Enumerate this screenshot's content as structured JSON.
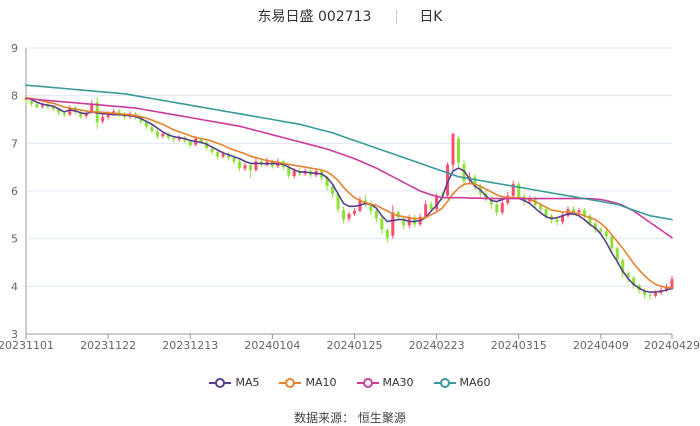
{
  "title": {
    "stock": "东易日盛 002713",
    "period": "日K"
  },
  "source": "数据来源：  恒生聚源",
  "colors": {
    "up": "#ff4d6d",
    "down": "#8ae234",
    "grid": "#dfe6f3",
    "axis": "#666666"
  },
  "chart_data": {
    "type": "candlestick",
    "ylim": [
      3,
      9
    ],
    "yticks": [
      3,
      4,
      5,
      6,
      7,
      8,
      9
    ],
    "xticks": [
      "20231101",
      "20231122",
      "20231213",
      "20240104",
      "20240125",
      "20240223",
      "20240315",
      "20240409",
      "20240429"
    ],
    "x_tick_index": [
      0,
      15,
      30,
      45,
      60,
      75,
      90,
      105,
      118
    ],
    "candles": [
      [
        7.95,
        7.9,
        7.99,
        7.84
      ],
      [
        7.89,
        7.82,
        7.94,
        7.78
      ],
      [
        7.82,
        7.76,
        7.86,
        7.72
      ],
      [
        7.77,
        7.8,
        7.85,
        7.73
      ],
      [
        7.82,
        7.76,
        7.86,
        7.71
      ],
      [
        7.77,
        7.72,
        7.8,
        7.67
      ],
      [
        7.71,
        7.64,
        7.75,
        7.58
      ],
      [
        7.63,
        7.6,
        7.69,
        7.55
      ],
      [
        7.6,
        7.74,
        7.8,
        7.57
      ],
      [
        7.75,
        7.66,
        7.8,
        7.6
      ],
      [
        7.66,
        7.56,
        7.71,
        7.51
      ],
      [
        7.57,
        7.64,
        7.69,
        7.53
      ],
      [
        7.65,
        7.82,
        7.9,
        7.62
      ],
      [
        7.86,
        7.44,
        7.96,
        7.3
      ],
      [
        7.46,
        7.55,
        7.6,
        7.41
      ],
      [
        7.55,
        7.62,
        7.68,
        7.5
      ],
      [
        7.62,
        7.67,
        7.72,
        7.58
      ],
      [
        7.68,
        7.62,
        7.72,
        7.56
      ],
      [
        7.61,
        7.55,
        7.66,
        7.5
      ],
      [
        7.56,
        7.62,
        7.67,
        7.52
      ],
      [
        7.62,
        7.55,
        7.66,
        7.5
      ],
      [
        7.55,
        7.45,
        7.58,
        7.4
      ],
      [
        7.44,
        7.35,
        7.48,
        7.3
      ],
      [
        7.34,
        7.26,
        7.38,
        7.21
      ],
      [
        7.25,
        7.14,
        7.29,
        7.09
      ],
      [
        7.15,
        7.2,
        7.25,
        7.1
      ],
      [
        7.2,
        7.12,
        7.24,
        7.07
      ],
      [
        7.11,
        7.08,
        7.15,
        7.02
      ],
      [
        7.08,
        7.12,
        7.17,
        7.03
      ],
      [
        7.12,
        7.05,
        7.16,
        7.0
      ],
      [
        7.04,
        6.96,
        7.08,
        6.9
      ],
      [
        6.97,
        7.1,
        7.15,
        6.93
      ],
      [
        7.1,
        7.03,
        7.14,
        6.98
      ],
      [
        7.02,
        6.9,
        7.06,
        6.85
      ],
      [
        6.89,
        6.82,
        6.93,
        6.77
      ],
      [
        6.82,
        6.72,
        6.86,
        6.66
      ],
      [
        6.72,
        6.78,
        6.83,
        6.68
      ],
      [
        6.78,
        6.7,
        6.82,
        6.64
      ],
      [
        6.7,
        6.62,
        6.75,
        6.56
      ],
      [
        6.62,
        6.48,
        6.66,
        6.42
      ],
      [
        6.47,
        6.54,
        6.59,
        6.42
      ],
      [
        6.54,
        6.44,
        6.58,
        6.28
      ],
      [
        6.44,
        6.62,
        6.72,
        6.4
      ],
      [
        6.62,
        6.55,
        6.68,
        6.5
      ],
      [
        6.55,
        6.62,
        6.7,
        6.51
      ],
      [
        6.62,
        6.52,
        6.66,
        6.47
      ],
      [
        6.52,
        6.62,
        6.68,
        6.48
      ],
      [
        6.62,
        6.5,
        6.66,
        6.45
      ],
      [
        6.5,
        6.32,
        6.55,
        6.26
      ],
      [
        6.31,
        6.42,
        6.48,
        6.27
      ],
      [
        6.42,
        6.36,
        6.48,
        6.31
      ],
      [
        6.36,
        6.42,
        6.47,
        6.32
      ],
      [
        6.42,
        6.33,
        6.46,
        6.28
      ],
      [
        6.33,
        6.42,
        6.48,
        6.29
      ],
      [
        6.42,
        6.28,
        6.46,
        6.22
      ],
      [
        6.28,
        6.1,
        6.32,
        6.02
      ],
      [
        6.1,
        5.94,
        6.13,
        5.86
      ],
      [
        5.94,
        5.62,
        5.97,
        5.55
      ],
      [
        5.6,
        5.4,
        5.68,
        5.32
      ],
      [
        5.42,
        5.52,
        5.56,
        5.36
      ],
      [
        5.52,
        5.58,
        5.64,
        5.48
      ],
      [
        5.58,
        5.8,
        5.88,
        5.55
      ],
      [
        5.8,
        5.74,
        5.92,
        5.66
      ],
      [
        5.74,
        5.58,
        5.8,
        5.5
      ],
      [
        5.58,
        5.42,
        5.63,
        5.34
      ],
      [
        5.42,
        5.2,
        5.46,
        5.1
      ],
      [
        5.18,
        5.02,
        5.22,
        4.92
      ],
      [
        5.06,
        5.55,
        5.7,
        5.0
      ],
      [
        5.55,
        5.45,
        5.6,
        5.38
      ],
      [
        5.42,
        5.28,
        5.48,
        5.2
      ],
      [
        5.28,
        5.44,
        5.5,
        5.22
      ],
      [
        5.44,
        5.3,
        5.5,
        5.24
      ],
      [
        5.3,
        5.46,
        5.52,
        5.26
      ],
      [
        5.46,
        5.72,
        5.8,
        5.42
      ],
      [
        5.72,
        5.62,
        5.78,
        5.56
      ],
      [
        5.62,
        5.88,
        5.95,
        5.58
      ],
      [
        5.88,
        5.86,
        5.98,
        5.8
      ],
      [
        5.9,
        6.55,
        6.6,
        5.88
      ],
      [
        6.55,
        7.2,
        7.22,
        6.45
      ],
      [
        7.1,
        6.6,
        7.15,
        6.5
      ],
      [
        6.56,
        6.2,
        6.65,
        6.1
      ],
      [
        6.22,
        6.3,
        6.4,
        6.15
      ],
      [
        6.3,
        6.1,
        6.35,
        6.02
      ],
      [
        6.1,
        5.95,
        6.15,
        5.88
      ],
      [
        5.95,
        5.85,
        6.02,
        5.78
      ],
      [
        5.85,
        5.72,
        5.9,
        5.62
      ],
      [
        5.72,
        5.55,
        5.78,
        5.48
      ],
      [
        5.55,
        5.75,
        5.8,
        5.5
      ],
      [
        5.75,
        5.9,
        5.98,
        5.7
      ],
      [
        5.9,
        6.15,
        6.22,
        5.85
      ],
      [
        6.15,
        5.88,
        6.2,
        5.82
      ],
      [
        5.88,
        5.78,
        5.95,
        5.7
      ],
      [
        5.78,
        5.85,
        5.9,
        5.72
      ],
      [
        5.85,
        5.7,
        5.9,
        5.64
      ],
      [
        5.7,
        5.62,
        5.75,
        5.55
      ],
      [
        5.62,
        5.48,
        5.66,
        5.42
      ],
      [
        5.48,
        5.4,
        5.52,
        5.32
      ],
      [
        5.4,
        5.35,
        5.45,
        5.28
      ],
      [
        5.35,
        5.48,
        5.55,
        5.3
      ],
      [
        5.48,
        5.62,
        5.68,
        5.44
      ],
      [
        5.62,
        5.55,
        5.68,
        5.5
      ],
      [
        5.55,
        5.6,
        5.65,
        5.5
      ],
      [
        5.6,
        5.48,
        5.64,
        5.42
      ],
      [
        5.48,
        5.32,
        5.52,
        5.25
      ],
      [
        5.32,
        5.2,
        5.36,
        5.12
      ],
      [
        5.2,
        5.15,
        5.24,
        5.08
      ],
      [
        5.15,
        5.05,
        5.2,
        4.98
      ],
      [
        5.05,
        4.8,
        5.08,
        4.72
      ],
      [
        4.8,
        4.55,
        4.84,
        4.45
      ],
      [
        4.55,
        4.28,
        4.6,
        4.18
      ],
      [
        4.28,
        4.18,
        4.32,
        4.08
      ],
      [
        4.18,
        4.02,
        4.22,
        3.95
      ],
      [
        4.02,
        3.92,
        4.06,
        3.85
      ],
      [
        3.92,
        3.82,
        3.96,
        3.74
      ],
      [
        3.82,
        3.8,
        3.88,
        3.72
      ],
      [
        3.8,
        3.86,
        3.92,
        3.76
      ],
      [
        3.86,
        3.92,
        3.98,
        3.82
      ],
      [
        3.92,
        3.98,
        4.05,
        3.88
      ],
      [
        3.95,
        4.15,
        4.22,
        3.92
      ]
    ],
    "series": [
      {
        "name": "MA5",
        "color": "#5b3d8c",
        "values": [
          7.95,
          7.92,
          7.86,
          7.82,
          7.8,
          7.78,
          7.72,
          7.66,
          7.7,
          7.68,
          7.64,
          7.62,
          7.66,
          7.64,
          7.62,
          7.62,
          7.6,
          7.6,
          7.59,
          7.58,
          7.56,
          7.52,
          7.46,
          7.4,
          7.32,
          7.24,
          7.18,
          7.14,
          7.12,
          7.1,
          7.06,
          7.04,
          7.02,
          6.98,
          6.92,
          6.86,
          6.8,
          6.76,
          6.72,
          6.68,
          6.62,
          6.58,
          6.58,
          6.58,
          6.57,
          6.58,
          6.57,
          6.56,
          6.5,
          6.44,
          6.4,
          6.4,
          6.38,
          6.37,
          6.36,
          6.28,
          6.14,
          5.94,
          5.74,
          5.68,
          5.68,
          5.7,
          5.74,
          5.72,
          5.64,
          5.48,
          5.36,
          5.38,
          5.4,
          5.4,
          5.36,
          5.36,
          5.38,
          5.44,
          5.58,
          5.7,
          5.86,
          6.18,
          6.42,
          6.48,
          6.42,
          6.26,
          6.1,
          6.02,
          5.9,
          5.8,
          5.78,
          5.82,
          5.86,
          5.86,
          5.85,
          5.8,
          5.74,
          5.64,
          5.54,
          5.46,
          5.42,
          5.44,
          5.48,
          5.52,
          5.52,
          5.48,
          5.4,
          5.3,
          5.22,
          5.1,
          4.92,
          4.7,
          4.52,
          4.32,
          4.16,
          4.04,
          3.96,
          3.9,
          3.88,
          3.88,
          3.9,
          3.92,
          3.96
        ]
      },
      {
        "name": "MA10",
        "color": "#e6822e",
        "values": [
          7.96,
          7.94,
          7.92,
          7.89,
          7.86,
          7.84,
          7.8,
          7.76,
          7.74,
          7.72,
          7.7,
          7.68,
          7.66,
          7.66,
          7.65,
          7.64,
          7.63,
          7.62,
          7.61,
          7.6,
          7.58,
          7.56,
          7.53,
          7.49,
          7.44,
          7.4,
          7.34,
          7.28,
          7.24,
          7.2,
          7.16,
          7.12,
          7.1,
          7.08,
          7.04,
          7.0,
          6.96,
          6.9,
          6.86,
          6.82,
          6.78,
          6.73,
          6.7,
          6.67,
          6.64,
          6.62,
          6.6,
          6.58,
          6.56,
          6.54,
          6.52,
          6.5,
          6.48,
          6.46,
          6.44,
          6.4,
          6.32,
          6.22,
          6.08,
          5.96,
          5.86,
          5.8,
          5.76,
          5.72,
          5.7,
          5.64,
          5.58,
          5.52,
          5.48,
          5.46,
          5.44,
          5.42,
          5.42,
          5.44,
          5.5,
          5.56,
          5.64,
          5.78,
          5.94,
          6.06,
          6.14,
          6.16,
          6.14,
          6.1,
          6.04,
          5.98,
          5.92,
          5.88,
          5.86,
          5.86,
          5.86,
          5.85,
          5.82,
          5.78,
          5.72,
          5.66,
          5.6,
          5.58,
          5.56,
          5.56,
          5.55,
          5.52,
          5.48,
          5.44,
          5.4,
          5.32,
          5.22,
          5.08,
          4.94,
          4.8,
          4.64,
          4.48,
          4.34,
          4.22,
          4.12,
          4.04,
          4.0,
          3.98,
          3.97
        ]
      },
      {
        "name": "MA30",
        "color": "#cc3b9a",
        "values": [
          7.94,
          7.93,
          7.92,
          7.91,
          7.9,
          7.89,
          7.88,
          7.87,
          7.86,
          7.85,
          7.84,
          7.83,
          7.82,
          7.81,
          7.8,
          7.79,
          7.78,
          7.77,
          7.76,
          7.75,
          7.74,
          7.72,
          7.7,
          7.68,
          7.66,
          7.64,
          7.62,
          7.6,
          7.58,
          7.56,
          7.54,
          7.52,
          7.5,
          7.48,
          7.46,
          7.44,
          7.42,
          7.4,
          7.38,
          7.36,
          7.33,
          7.3,
          7.27,
          7.24,
          7.21,
          7.18,
          7.15,
          7.12,
          7.09,
          7.06,
          7.03,
          7.0,
          6.97,
          6.94,
          6.91,
          6.88,
          6.84,
          6.8,
          6.76,
          6.72,
          6.68,
          6.63,
          6.58,
          6.53,
          6.48,
          6.42,
          6.36,
          6.3,
          6.24,
          6.18,
          6.12,
          6.06,
          6.0,
          5.96,
          5.92,
          5.89,
          5.86,
          5.86,
          5.86,
          5.86,
          5.86,
          5.85,
          5.85,
          5.85,
          5.84,
          5.84,
          5.84,
          5.84,
          5.84,
          5.84,
          5.84,
          5.84,
          5.84,
          5.84,
          5.84,
          5.84,
          5.84,
          5.84,
          5.84,
          5.84,
          5.84,
          5.84,
          5.84,
          5.84,
          5.83,
          5.82,
          5.8,
          5.77,
          5.74,
          5.7,
          5.64,
          5.58,
          5.5,
          5.42,
          5.34,
          5.26,
          5.18,
          5.1,
          5.02
        ]
      },
      {
        "name": "MA60",
        "color": "#3a9a9a",
        "values": [
          8.22,
          8.21,
          8.2,
          8.19,
          8.18,
          8.17,
          8.16,
          8.15,
          8.14,
          8.13,
          8.12,
          8.11,
          8.1,
          8.09,
          8.08,
          8.07,
          8.06,
          8.05,
          8.04,
          8.02,
          8.0,
          7.98,
          7.96,
          7.94,
          7.92,
          7.9,
          7.88,
          7.86,
          7.84,
          7.82,
          7.8,
          7.78,
          7.76,
          7.74,
          7.72,
          7.7,
          7.68,
          7.66,
          7.64,
          7.62,
          7.6,
          7.58,
          7.56,
          7.54,
          7.52,
          7.5,
          7.48,
          7.46,
          7.44,
          7.42,
          7.4,
          7.37,
          7.34,
          7.31,
          7.28,
          7.25,
          7.22,
          7.18,
          7.14,
          7.1,
          7.06,
          7.02,
          6.98,
          6.94,
          6.9,
          6.86,
          6.82,
          6.78,
          6.74,
          6.7,
          6.66,
          6.62,
          6.58,
          6.54,
          6.5,
          6.46,
          6.42,
          6.38,
          6.34,
          6.3,
          6.28,
          6.26,
          6.24,
          6.22,
          6.2,
          6.18,
          6.16,
          6.14,
          6.12,
          6.1,
          6.08,
          6.06,
          6.04,
          6.02,
          6.0,
          5.98,
          5.96,
          5.94,
          5.92,
          5.9,
          5.88,
          5.86,
          5.84,
          5.82,
          5.8,
          5.78,
          5.76,
          5.74,
          5.72,
          5.68,
          5.64,
          5.6,
          5.56,
          5.52,
          5.48,
          5.46,
          5.44,
          5.42,
          5.4
        ]
      }
    ]
  }
}
